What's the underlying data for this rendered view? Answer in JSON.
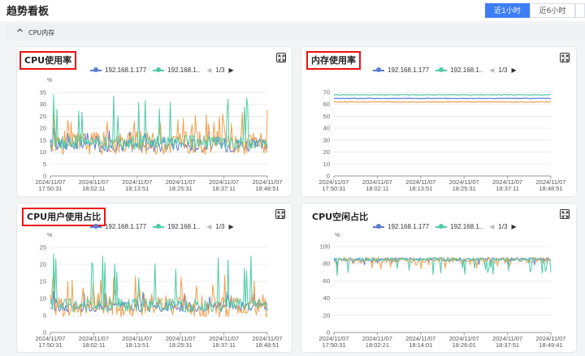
{
  "page": {
    "title": "趋势看板",
    "ranges": [
      {
        "label": "近1小时",
        "active": true
      },
      {
        "label": "近6小时",
        "active": false
      },
      {
        "label": "",
        "active": false
      }
    ],
    "section_label": "CPU内存",
    "section_icon": "chevron-up-icon"
  },
  "icons": {
    "expand": "fullscreen-expand-icon",
    "prev": "caret-left-icon",
    "next": "caret-right-icon"
  },
  "colors": {
    "accent": "#3d7ef5",
    "series1": "#5b7bd5",
    "series2": "#4ecba5",
    "series3": "#f2a04d",
    "highlight_box": "#ee1111"
  },
  "charts": [
    {
      "title": "CPU使用率",
      "legend": [
        "192.168.1.177",
        "192.168.1.."
      ],
      "page_indicator": "1/3",
      "unit": "%",
      "chart_data": {
        "type": "line",
        "ylim": [
          0,
          35
        ],
        "yticks": [
          "0",
          "5",
          "10",
          "15",
          "20",
          "25",
          "30",
          "35"
        ],
        "xticks": [
          [
            "2024/11/07",
            "17:50:31"
          ],
          [
            "2024/11/07",
            "18:02:11"
          ],
          [
            "2024/11/07",
            "18:13:51"
          ],
          [
            "2024/11/07",
            "18:25:31"
          ],
          [
            "2024/11/07",
            "18:37:11"
          ],
          [
            "2024/11/07",
            "18:48:51"
          ]
        ],
        "series": [
          {
            "name": "192.168.1.177",
            "color": "#5b7bd5",
            "base": 13,
            "amp": 3,
            "spike": 20
          },
          {
            "name": "192.168.1..",
            "color": "#4ecba5",
            "base": 14,
            "amp": 3,
            "spike": 34
          },
          {
            "color": "#f2a04d",
            "base": 14,
            "amp": 5,
            "spike": 28
          }
        ]
      }
    },
    {
      "title": "内存使用率",
      "legend": [
        "192.168.1.177",
        "192.168.1.."
      ],
      "page_indicator": "1/3",
      "unit": "%",
      "chart_data": {
        "type": "line",
        "ylim": [
          0,
          70
        ],
        "yticks": [
          "0",
          "10",
          "20",
          "30",
          "40",
          "50",
          "60",
          "70"
        ],
        "xticks": [
          [
            "2024/11/07",
            "17:50:31"
          ],
          [
            "2024/11/07",
            "18:02:11"
          ],
          [
            "2024/11/07",
            "18:13:51"
          ],
          [
            "2024/11/07",
            "18:25:31"
          ],
          [
            "2024/11/07",
            "18:37:11"
          ],
          [
            "2024/11/07",
            "18:48:51"
          ]
        ],
        "series": [
          {
            "name": "192.168.1.177",
            "color": "#5b7bd5",
            "base": 65,
            "amp": 0.3,
            "spike": 65
          },
          {
            "name": "192.168.1..",
            "color": "#4ecba5",
            "base": 68,
            "amp": 0.3,
            "spike": 68
          },
          {
            "color": "#f2a04d",
            "base": 62,
            "amp": 0.3,
            "spike": 62
          }
        ]
      }
    },
    {
      "title": "CPU用户使用占比",
      "legend": [
        "192.168.1.177",
        "192.168.1.."
      ],
      "page_indicator": "1/3",
      "unit": "%",
      "chart_data": {
        "type": "line",
        "ylim": [
          0,
          25
        ],
        "yticks": [
          "0",
          "5",
          "10",
          "15",
          "20",
          "25"
        ],
        "xticks": [
          [
            "2024/11/07",
            "17:50:31"
          ],
          [
            "2024/11/07",
            "18:02:11"
          ],
          [
            "2024/11/07",
            "18:13:51"
          ],
          [
            "2024/11/07",
            "18:25:31"
          ],
          [
            "2024/11/07",
            "18:37:11"
          ],
          [
            "2024/11/07",
            "18:48:51"
          ]
        ],
        "series": [
          {
            "name": "192.168.1.177",
            "color": "#5b7bd5",
            "base": 7.5,
            "amp": 1.5,
            "spike": 12
          },
          {
            "name": "192.168.1..",
            "color": "#4ecba5",
            "base": 8,
            "amp": 2,
            "spike": 23
          },
          {
            "color": "#f2a04d",
            "base": 8,
            "amp": 3.5,
            "spike": 17
          }
        ]
      }
    },
    {
      "title": "CPU空闲占比",
      "legend": [
        "192.168.1.177",
        "192.168.1.."
      ],
      "page_indicator": "1/3",
      "unit": "%",
      "chart_data": {
        "type": "line",
        "ylim": [
          0,
          100
        ],
        "yticks": [
          "0",
          "20",
          "40",
          "60",
          "80",
          "100"
        ],
        "xticks": [
          [
            "2024/11/07",
            "17:50:31"
          ],
          [
            "2024/11/07",
            "18:02:21"
          ],
          [
            "2024/11/07",
            "18:14:01"
          ],
          [
            "2024/11/07",
            "18:26:01"
          ],
          [
            "2024/11/07",
            "18:37:51"
          ],
          [
            "2024/11/07",
            "18:49:41"
          ]
        ],
        "series": [
          {
            "name": "192.168.1.177",
            "color": "#5b7bd5",
            "base": 85,
            "amp": 2,
            "spike": 78
          },
          {
            "name": "192.168.1..",
            "color": "#4ecba5",
            "base": 85,
            "amp": 2,
            "spike": 66
          },
          {
            "color": "#f2a04d",
            "base": 84,
            "amp": 3.5,
            "spike": 74
          }
        ]
      }
    }
  ]
}
